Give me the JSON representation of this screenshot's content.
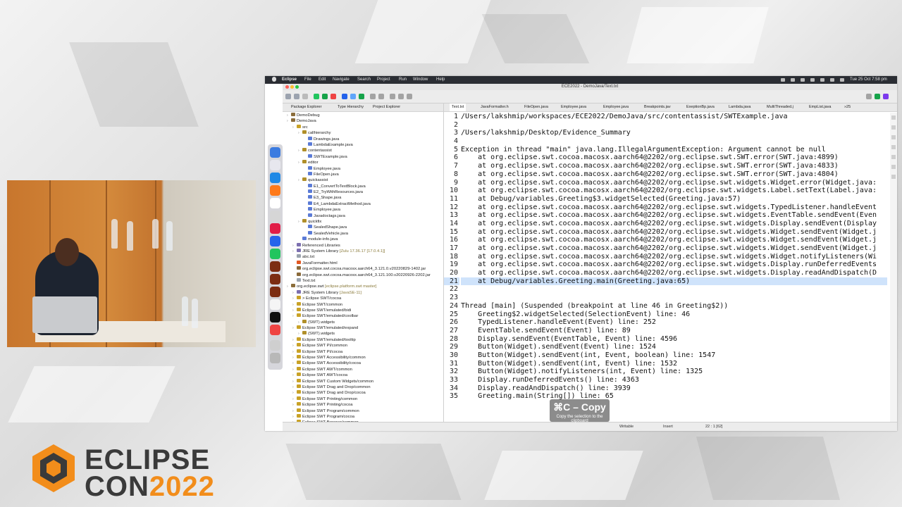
{
  "menubar": {
    "items": [
      "Eclipse",
      "File",
      "Edit",
      "Navigate",
      "Search",
      "Project",
      "Run",
      "Window",
      "Help"
    ],
    "clock": "Tue 25 Oct  7:58 pm"
  },
  "window": {
    "title": "ECE2022 - DemoJava/Text.txt"
  },
  "package_explorer": {
    "tabs": [
      "Package Explorer",
      "Type Hierarchy",
      "Project Explorer"
    ],
    "tree": [
      {
        "label": "DemoDebug",
        "depth": 0,
        "kind": "project"
      },
      {
        "label": "DemoJava",
        "depth": 0,
        "kind": "project"
      },
      {
        "label": "src",
        "depth": 1,
        "kind": "folder"
      },
      {
        "label": "callhierarchy",
        "depth": 2,
        "kind": "package"
      },
      {
        "label": "Drawings.java",
        "depth": 3,
        "kind": "file"
      },
      {
        "label": "LambdaExample.java",
        "depth": 3,
        "kind": "file"
      },
      {
        "label": "contentassist",
        "depth": 2,
        "kind": "package"
      },
      {
        "label": "SWTExample.java",
        "depth": 3,
        "kind": "file"
      },
      {
        "label": "editor",
        "depth": 2,
        "kind": "package"
      },
      {
        "label": "Employee.java",
        "depth": 3,
        "kind": "file"
      },
      {
        "label": "FileOpen.java",
        "depth": 3,
        "kind": "file"
      },
      {
        "label": "quickassist",
        "depth": 2,
        "kind": "package"
      },
      {
        "label": "E1_ConvertToTextBlock.java",
        "depth": 3,
        "kind": "file"
      },
      {
        "label": "E2_TryWithResources.java",
        "depth": 3,
        "kind": "file"
      },
      {
        "label": "E3_Shape.java",
        "depth": 3,
        "kind": "file"
      },
      {
        "label": "E4_LambdaExtractMethod.java",
        "depth": 3,
        "kind": "file"
      },
      {
        "label": "Employee.java",
        "depth": 3,
        "kind": "file"
      },
      {
        "label": "Javadoctags.java",
        "depth": 3,
        "kind": "file"
      },
      {
        "label": "quickfix",
        "depth": 2,
        "kind": "package"
      },
      {
        "label": "SealedShape.java",
        "depth": 3,
        "kind": "file"
      },
      {
        "label": "SealedVehicle.java",
        "depth": 3,
        "kind": "file"
      },
      {
        "label": "module-info.java",
        "depth": 2,
        "kind": "file"
      },
      {
        "label": "Referenced Libraries",
        "depth": 1,
        "kind": "lib"
      },
      {
        "label": "JRE System Library",
        "sub": "[Zulu 17.36.17 [17.0.4.1]]",
        "depth": 1,
        "kind": "lib"
      },
      {
        "label": "abc.txt",
        "depth": 1,
        "kind": "text"
      },
      {
        "label": "JavaFormatter.html",
        "depth": 1,
        "kind": "html"
      },
      {
        "label": "org.eclipse.swt.cocoa.macosx.aarch64_3.121.0.v20220829-1402.jar",
        "depth": 1,
        "kind": "jar"
      },
      {
        "label": "org.eclipse.swt.cocoa.macosx.aarch64_3.121.100.v20220926-2202.jar",
        "depth": 1,
        "kind": "jar"
      },
      {
        "label": "Text.txt",
        "depth": 1,
        "kind": "text"
      },
      {
        "label": "org.eclipse.swt",
        "sub": "[eclipse.platform.swt master]",
        "depth": 0,
        "kind": "project"
      },
      {
        "label": "JRE System Library",
        "sub": "[JavaSE-11]",
        "depth": 1,
        "kind": "lib"
      },
      {
        "label": "> Eclipse SWT/cocoa",
        "depth": 1,
        "kind": "folder"
      },
      {
        "label": "Eclipse SWT/common",
        "depth": 1,
        "kind": "folder"
      },
      {
        "label": "Eclipse SWT/emulated/bidi",
        "depth": 1,
        "kind": "folder"
      },
      {
        "label": "Eclipse SWT/emulated/coolbar",
        "depth": 1,
        "kind": "folder"
      },
      {
        "label": "(SWT).widgets",
        "depth": 2,
        "kind": "package"
      },
      {
        "label": "Eclipse SWT/emulated/expand",
        "depth": 1,
        "kind": "folder"
      },
      {
        "label": "(SWT).widgets",
        "depth": 2,
        "kind": "package"
      },
      {
        "label": "Eclipse SWT/emulated/tooltip",
        "depth": 1,
        "kind": "folder"
      },
      {
        "label": "Eclipse SWT PI/common",
        "depth": 1,
        "kind": "folder"
      },
      {
        "label": "Eclipse SWT PI/cocoa",
        "depth": 1,
        "kind": "folder"
      },
      {
        "label": "Eclipse SWT Accessibility/common",
        "depth": 1,
        "kind": "folder"
      },
      {
        "label": "Eclipse SWT Accessibility/cocoa",
        "depth": 1,
        "kind": "folder"
      },
      {
        "label": "Eclipse SWT AWT/common",
        "depth": 1,
        "kind": "folder"
      },
      {
        "label": "Eclipse SWT AWT/cocoa",
        "depth": 1,
        "kind": "folder"
      },
      {
        "label": "Eclipse SWT Custom Widgets/common",
        "depth": 1,
        "kind": "folder"
      },
      {
        "label": "Eclipse SWT Drag and Drop/common",
        "depth": 1,
        "kind": "folder"
      },
      {
        "label": "Eclipse SWT Drag and Drop/cocoa",
        "depth": 1,
        "kind": "folder"
      },
      {
        "label": "Eclipse SWT Printing/common",
        "depth": 1,
        "kind": "folder"
      },
      {
        "label": "Eclipse SWT Printing/cocoa",
        "depth": 1,
        "kind": "folder"
      },
      {
        "label": "Eclipse SWT Program/common",
        "depth": 1,
        "kind": "folder"
      },
      {
        "label": "Eclipse SWT Program/cocoa",
        "depth": 1,
        "kind": "folder"
      },
      {
        "label": "Eclipse SWT Browser/common",
        "depth": 1,
        "kind": "folder"
      }
    ]
  },
  "editor": {
    "tabs": [
      "Text.txt",
      "JavaFormatter.h",
      "FileOpen.java",
      "Employee.java",
      "Employee.java",
      "Breakpoints.jav",
      "ExeptionBp.java",
      "Lambda.java",
      "MultiThreaded.j",
      "EmpList.java",
      "»25"
    ],
    "active_tab": 0,
    "highlight_line": 21,
    "lines": [
      "/Users/lakshmip/workspaces/ECE2022/DemoJava/src/contentassist/SWTExample.java",
      "",
      "/Users/lakshmip/Desktop/Evidence_Summary",
      "",
      "Exception in thread \"main\" java.lang.IllegalArgumentException: Argument cannot be null",
      "    at org.eclipse.swt.cocoa.macosx.aarch64@2202/org.eclipse.swt.SWT.error(SWT.java:4899)",
      "    at org.eclipse.swt.cocoa.macosx.aarch64@2202/org.eclipse.swt.SWT.error(SWT.java:4833)",
      "    at org.eclipse.swt.cocoa.macosx.aarch64@2202/org.eclipse.swt.SWT.error(SWT.java:4804)",
      "    at org.eclipse.swt.cocoa.macosx.aarch64@2202/org.eclipse.swt.widgets.Widget.error(Widget.java:",
      "    at org.eclipse.swt.cocoa.macosx.aarch64@2202/org.eclipse.swt.widgets.Label.setText(Label.java:",
      "    at Debug/variables.Greeting$3.widgetSelected(Greeting.java:57)",
      "    at org.eclipse.swt.cocoa.macosx.aarch64@2202/org.eclipse.swt.widgets.TypedListener.handleEvent",
      "    at org.eclipse.swt.cocoa.macosx.aarch64@2202/org.eclipse.swt.widgets.EventTable.sendEvent(Even",
      "    at org.eclipse.swt.cocoa.macosx.aarch64@2202/org.eclipse.swt.widgets.Display.sendEvent(Display",
      "    at org.eclipse.swt.cocoa.macosx.aarch64@2202/org.eclipse.swt.widgets.Widget.sendEvent(Widget.j",
      "    at org.eclipse.swt.cocoa.macosx.aarch64@2202/org.eclipse.swt.widgets.Widget.sendEvent(Widget.j",
      "    at org.eclipse.swt.cocoa.macosx.aarch64@2202/org.eclipse.swt.widgets.Widget.sendEvent(Widget.j",
      "    at org.eclipse.swt.cocoa.macosx.aarch64@2202/org.eclipse.swt.widgets.Widget.notifyListeners(Wi",
      "    at org.eclipse.swt.cocoa.macosx.aarch64@2202/org.eclipse.swt.widgets.Display.runDeferredEvents",
      "    at org.eclipse.swt.cocoa.macosx.aarch64@2202/org.eclipse.swt.widgets.Display.readAndDispatch(D",
      "    at Debug/variables.Greeting.main(Greeting.java:65)",
      "",
      "",
      "Thread [main] (Suspended (breakpoint at line 46 in Greeting$2))",
      "    Greeting$2.widgetSelected(SelectionEvent) line: 46",
      "    TypedListener.handleEvent(Event) line: 252",
      "    EventTable.sendEvent(Event) line: 89",
      "    Display.sendEvent(EventTable, Event) line: 4596",
      "    Button(Widget).sendEvent(Event) line: 1524",
      "    Button(Widget).sendEvent(int, Event, boolean) line: 1547",
      "    Button(Widget).sendEvent(int, Event) line: 1532",
      "    Button(Widget).notifyListeners(int, Event) line: 1325",
      "    Display.runDeferredEvents() line: 4363",
      "    Display.readAndDispatch() line: 3939",
      "    Greeting.main(String[]) line: 65"
    ]
  },
  "statusbar": {
    "mode": "Writable",
    "insert": "Insert",
    "position": "22 : 1 [62]"
  },
  "toast": {
    "shortcut": "⌘C – Copy",
    "description": "Copy the selection to the clipboard"
  },
  "logo": {
    "line1": "ECLIPSE",
    "line2a": "CON",
    "line2b": "2022"
  },
  "colors": {
    "accent": "#f28d1b",
    "highlight": "#cfe3fb"
  }
}
